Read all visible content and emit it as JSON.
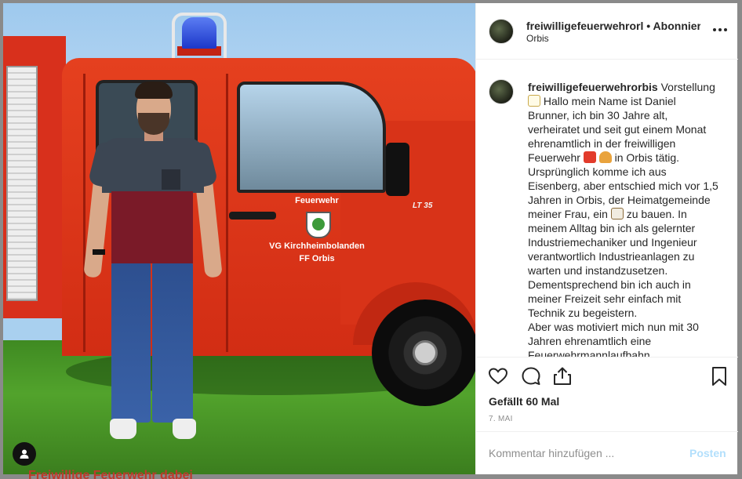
{
  "post": {
    "username": "freiwilligefeuerwehrorbis",
    "header_username": "freiwilligefeuerwehrorl",
    "separator": "•",
    "follow_status": "Abonniert",
    "location": "Orbis",
    "caption_username": "freiwilligefeuerwehrorbis",
    "caption_lines": [
      "Vorstellung",
      "Hallo mein Name ist Daniel",
      "Brunner, ich bin 30 Jahre alt,",
      "verheiratet und seit gut einem Monat",
      "ehrenamtlich in der freiwilligen",
      "Feuerwehr",
      "in Orbis tätig.",
      "Ursprünglich komme ich aus",
      "Eisenberg, aber entschied mich vor 1,5",
      "Jahren in Orbis, der Heimatgemeinde",
      "meiner Frau, ein",
      "zu bauen. In",
      "meinem Alltag bin ich als gelernter",
      "Industriemechaniker und Ingenieur",
      "verantwortlich Industrieanlagen zu",
      "warten und instandzusetzen.",
      "Dementsprechend bin ich auch in",
      "meiner Freizeit sehr einfach mit",
      "Technik zu begeistern.",
      "Aber was motiviert mich nun mit 30",
      "Jahren ehrenamtlich eine",
      "Feuerwehrmannlaufbahn"
    ],
    "likes": "Gefällt 60 Mal",
    "date": "7. MAI",
    "comment_placeholder": "Kommentar hinzufügen ...",
    "post_button": "Posten"
  },
  "photo": {
    "door_text_1": "Feuerwehr",
    "door_text_2": "VG Kirchheimbolanden",
    "door_text_3": "FF Orbis",
    "model_badge": "LT 35",
    "bottom_caption": "Freiwillige Feuerwehr dabei"
  },
  "icons": {
    "like": "heart-icon",
    "comment": "comment-icon",
    "share": "share-icon",
    "save": "bookmark-icon",
    "more": "more-options-icon",
    "user_tag": "user-tag-icon"
  },
  "colors": {
    "truck_red": "#d83318",
    "post_button_disabled": "#b2dffc",
    "muted_text": "#8e8e8e"
  }
}
